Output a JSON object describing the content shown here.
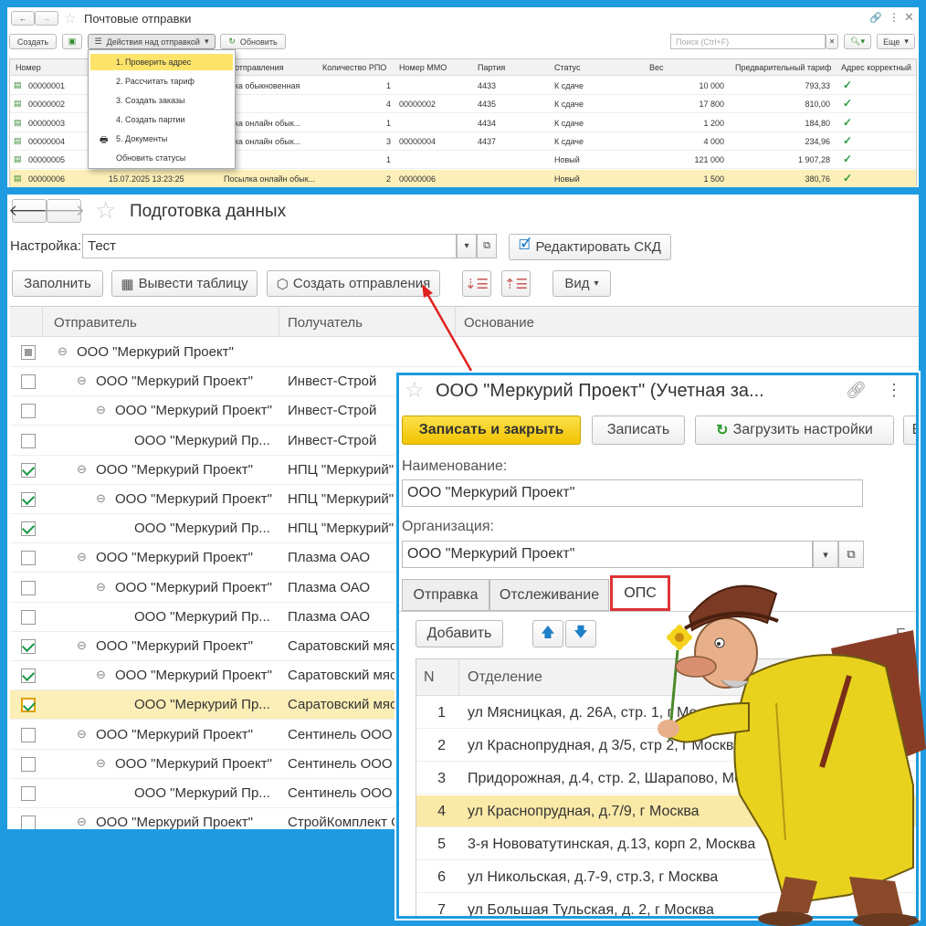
{
  "p1": {
    "title": "Почтовые отправки",
    "create": "Создать",
    "actions": "Действия над отправкой",
    "refresh": "Обновить",
    "search_ph": "Поиск (Ctrl+F)",
    "more": "Еще",
    "cols": [
      "Номер",
      "Дата",
      "отправления",
      "Количество РПО",
      "Номер ММО",
      "Партия",
      "Статус",
      "Вес",
      "Предварительный тариф",
      "Адрес корректный"
    ],
    "rows": [
      [
        "00000001",
        "",
        "ылка обыкновенная",
        "1",
        "",
        "4433",
        "К сдаче",
        "10 000",
        "793,33"
      ],
      [
        "00000002",
        "",
        "РТ",
        "4",
        "00000002",
        "4435",
        "К сдаче",
        "17 800",
        "810,00"
      ],
      [
        "00000003",
        "",
        "ылка онлайн обык...",
        "1",
        "",
        "4434",
        "К сдаче",
        "1 200",
        "184,80"
      ],
      [
        "00000004",
        "",
        "ылка онлайн обык...",
        "3",
        "00000004",
        "4437",
        "К сдаче",
        "4 000",
        "234,96"
      ],
      [
        "00000005",
        "",
        "РТ",
        "1",
        "",
        "",
        "Новый",
        "121 000",
        "1 907,28"
      ],
      [
        "00000006",
        "15.07.2025 13:23:25",
        "Посылка онлайн обык...",
        "2",
        "00000006",
        "",
        "Новый",
        "1 500",
        "380,76"
      ]
    ],
    "menu": [
      "1. Проверить адрес",
      "2. Рассчитать тариф",
      "3. Создать заказы",
      "4. Создать партии",
      "5. Документы",
      "Обновить статусы"
    ]
  },
  "p2": {
    "title": "Подготовка данных",
    "setting_label": "Настройка:",
    "setting_value": "Тест",
    "edit_skd": "Редактировать СКД",
    "fill": "Заполнить",
    "output_table": "Вывести таблицу",
    "create_shipments": "Создать отправления",
    "view": "Вид",
    "cols": [
      "Отправитель",
      "Получатель",
      "Основание"
    ],
    "rows": [
      {
        "level": 0,
        "checked": "partial",
        "sender": "ООО \"Меркурий Проект\"",
        "recipient": ""
      },
      {
        "level": 1,
        "checked": false,
        "sender": "ООО \"Меркурий Проект\"",
        "recipient": "Инвест-Строй"
      },
      {
        "level": 2,
        "checked": false,
        "sender": "ООО \"Меркурий Проект\"",
        "recipient": "Инвест-Строй"
      },
      {
        "level": 3,
        "checked": false,
        "sender": "ООО \"Меркурий Пр...",
        "recipient": "Инвест-Строй"
      },
      {
        "level": 1,
        "checked": true,
        "sender": "ООО \"Меркурий Проект\"",
        "recipient": "НПЦ \"Меркурий\""
      },
      {
        "level": 2,
        "checked": true,
        "sender": "ООО \"Меркурий Проект\"",
        "recipient": "НПЦ \"Меркурий\""
      },
      {
        "level": 3,
        "checked": true,
        "sender": "ООО \"Меркурий Пр...",
        "recipient": "НПЦ \"Меркурий\""
      },
      {
        "level": 1,
        "checked": false,
        "sender": "ООО \"Меркурий Проект\"",
        "recipient": "Плазма ОАО"
      },
      {
        "level": 2,
        "checked": false,
        "sender": "ООО \"Меркурий Проект\"",
        "recipient": "Плазма ОАО"
      },
      {
        "level": 3,
        "checked": false,
        "sender": "ООО \"Меркурий Пр...",
        "recipient": "Плазма ОАО"
      },
      {
        "level": 1,
        "checked": true,
        "sender": "ООО \"Меркурий Проект\"",
        "recipient": "Саратовский мяс"
      },
      {
        "level": 2,
        "checked": true,
        "sender": "ООО \"Меркурий Проект\"",
        "recipient": "Саратовский мяс"
      },
      {
        "level": 3,
        "checked": true,
        "sender": "ООО \"Меркурий Пр...",
        "recipient": "Саратовский мяс"
      },
      {
        "level": 1,
        "checked": false,
        "sender": "ООО \"Меркурий Проект\"",
        "recipient": "Сентинель ООО"
      },
      {
        "level": 2,
        "checked": false,
        "sender": "ООО \"Меркурий Проект\"",
        "recipient": "Сентинель ООО"
      },
      {
        "level": 3,
        "checked": false,
        "sender": "ООО \"Меркурий Пр...",
        "recipient": "Сентинель ООО"
      },
      {
        "level": 1,
        "checked": false,
        "sender": "ООО \"Меркурий Проект\"",
        "recipient": "СтройКомплект О"
      }
    ]
  },
  "p3": {
    "title": "ООО \"Меркурий Проект\" (Учетная за...",
    "save_close": "Записать и закрыть",
    "save": "Записать",
    "load_settings": "Загрузить настройки",
    "name_label": "Наименование:",
    "name_value": "ООО \"Меркурий Проект\"",
    "org_label": "Организация:",
    "org_value": "ООО \"Меркурий Проект\"",
    "tabs": [
      "Отправка",
      "Отслеживание",
      "ОПС"
    ],
    "add": "Добавить",
    "cols": [
      "N",
      "Отделение"
    ],
    "rows": [
      [
        "1",
        "ул Мясницкая, д. 26А, стр. 1, г Москва"
      ],
      [
        "2",
        "ул Краснопрудная, д 3/5, стр 2, г Москва"
      ],
      [
        "3",
        "Придорожная, д.4, стр. 2, Шарапово, Москва"
      ],
      [
        "4",
        "ул Краснопрудная, д.7/9, г Москва"
      ],
      [
        "5",
        "3-я Нововатутинская, д.13, корп 2, Москва"
      ],
      [
        "6",
        "ул Никольская, д.7-9, стр.3, г Москва"
      ],
      [
        "7",
        "ул Большая Тульская, д. 2, г Москва"
      ]
    ]
  }
}
